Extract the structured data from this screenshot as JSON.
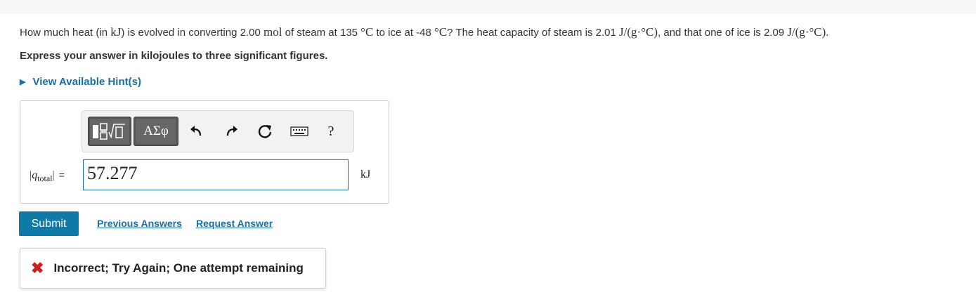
{
  "question": {
    "p1": "How much heat (in ",
    "m_kJ": "kJ",
    "p2": ") is evolved in converting 2.00 ",
    "m_mol": "mol",
    "p3": " of steam at 135 ",
    "m_degC1": "°C",
    "p4": " to ice at -48 ",
    "m_degC2": "°C",
    "p5": "? The heat capacity of steam is 2.01 ",
    "m_unit1": "J/(g·°C)",
    "p6": ", and that one of ice is 2.09 ",
    "m_unit2": "J/(g·°C)",
    "p7": "."
  },
  "instruction": "Express your answer in kilojoules to three significant figures.",
  "hint": {
    "label": "View Available Hint(s)"
  },
  "toolbar": {
    "greek_label": "ΑΣφ",
    "help_label": "?",
    "icons": [
      "templates-icon",
      "greek-letters-icon",
      "undo-icon",
      "redo-icon",
      "reset-icon",
      "keyboard-icon",
      "help-icon"
    ]
  },
  "answer": {
    "var_main": "q",
    "var_sub": "total",
    "equals": "=",
    "value": "57.277",
    "unit": "kJ"
  },
  "actions": {
    "submit": "Submit",
    "previous": "Previous Answers",
    "request": "Request Answer"
  },
  "feedback": {
    "message": "Incorrect; Try Again; One attempt remaining",
    "color": "#cc1f1f"
  },
  "colors": {
    "link": "#1a6fa0",
    "submit_bg": "#107aa6",
    "input_border": "#1a6f9a"
  }
}
